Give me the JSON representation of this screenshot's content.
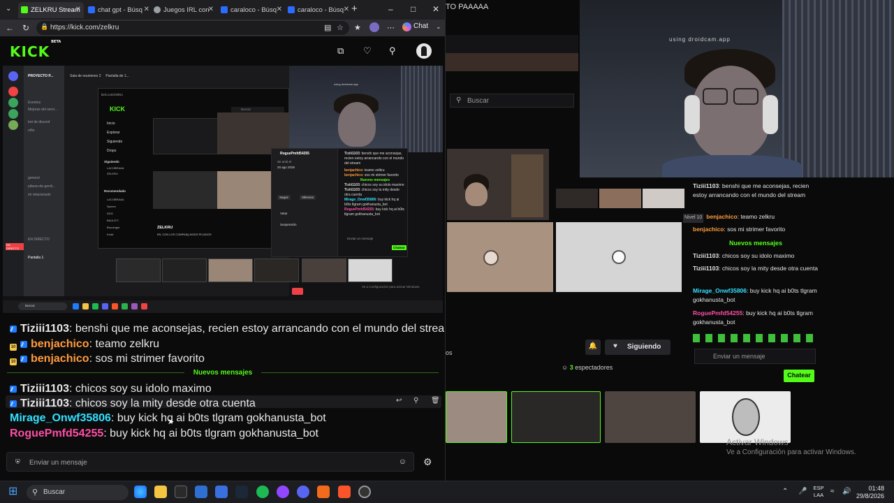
{
  "browser": {
    "tabs": [
      {
        "label": "ZELKRU Stream",
        "active": true,
        "fav_color": "#53fc18"
      },
      {
        "label": "chat gpt - Búsq",
        "active": false,
        "fav_color": "#2b6cff"
      },
      {
        "label": "Juegos IRL con",
        "active": false,
        "fav_color": "#9aa0a6"
      },
      {
        "label": "caraloco - Búsq",
        "active": false,
        "fav_color": "#2b6cff"
      },
      {
        "label": "caraloco - Búsq",
        "active": false,
        "fav_color": "#2b6cff"
      }
    ],
    "url": "https://kick.com/zelkru",
    "chat_button": "Chat"
  },
  "kick": {
    "logo": "KICK",
    "logo_badge": "BETA"
  },
  "nested": {
    "server_name": "PROYECTO P...",
    "inner_search": "Buscar",
    "inner_url": "kick.com/zelkru",
    "inner_nav": [
      "Inicio",
      "Explorar",
      "Siguiendo",
      "Drops"
    ],
    "inner_following_header": "Siguiendo",
    "inner_recommended_header": "Recomendado",
    "inner_channels": [
      "LACOBRAAA",
      "ZELKRU",
      "LACOBRAAA",
      "Spreen",
      "DDG",
      "BAULETI",
      "Brunenger",
      "Kodd"
    ],
    "inner_stream_title": "ZELKRU",
    "inner_stream_sub": "IRL CON LOS COMPAS|| MODS PICADOS",
    "inner_panel_user": "RoguePmfd54255",
    "inner_panel_joined": "Se unió el",
    "inner_panel_date": "20 ago 2026",
    "inner_follow_btn": "Seguir",
    "inner_silence_btn": "Silenciar",
    "inner_ban": "Vetar",
    "inner_suspend": "Suspensión",
    "inner_new": "Nuevos mensajes",
    "inner_send": "Enviar un mensaje",
    "inner_chat_btn": "Chatear",
    "dc_live": "EN DIRECTO",
    "dc_screen": "Pantalla 1",
    "taskbar_search": "Buscar",
    "activate": "Ve a Configuración para activar Windows."
  },
  "background": {
    "title_fragment": "TO PAAAAA",
    "search_placeholder": "Buscar",
    "cam_caption": "using droidcam.app",
    "chat": [
      {
        "user": "Tiziii1103",
        "color": "#e8e8e8",
        "text": "benshi que me aconsejas, recien estoy arrancando con el mundo del stream"
      },
      {
        "user": "benjachico",
        "color": "#ff9b3d",
        "text": "teamo zelkru"
      },
      {
        "user": "benjachico",
        "color": "#ff9b3d",
        "text": "sos mi strimer favorito"
      },
      {
        "user": "Tiziii1103",
        "color": "#e8e8e8",
        "text": "chicos soy su idolo maximo"
      },
      {
        "user": "Tiziii1103",
        "color": "#e8e8e8",
        "text": "chicos soy la mity desde otra cuenta"
      },
      {
        "user": "Mirage_Onwf35806",
        "color": "#33e1ff",
        "text": "buy kick hq ai b0ts tlgram gokhanusta_bot"
      },
      {
        "user": "RoguePmfd54255",
        "color": "#ff4fa3",
        "text": "buy kick hq ai b0ts tlgram gokhanusta_bot"
      }
    ],
    "new_messages": "Nuevos mensajes",
    "nivel_tag": "Nivel 10",
    "send_placeholder": "Enviar un mensaje",
    "chat_button": "Chatear",
    "follow_button": "Siguiendo",
    "viewers_count": "3",
    "viewers_label": "espectadores",
    "sidebar_fragment": "os",
    "activate_title": "Activar Windows",
    "activate_text": "Ve a Configuración para activar Windows."
  },
  "chat": {
    "messages": [
      {
        "badges": [
          "kick"
        ],
        "user": "Tiziii1103",
        "user_color": "#e8e8e8",
        "text": ": benshi que me aconsejas, recien estoy arrancando con el mundo del stream"
      },
      {
        "badges": [
          "ten",
          "kick"
        ],
        "user": "benjachico",
        "user_color": "#ff9b3d",
        "text": ": teamo zelkru"
      },
      {
        "badges": [
          "ten",
          "kick"
        ],
        "user": "benjachico",
        "user_color": "#ff9b3d",
        "text": ": sos mi strimer favorito"
      },
      {
        "badges": [
          "kick"
        ],
        "user": "Tiziii1103",
        "user_color": "#e8e8e8",
        "text": ": chicos soy su idolo maximo"
      },
      {
        "badges": [
          "kick"
        ],
        "user": "Tiziii1103",
        "user_color": "#e8e8e8",
        "text": ": chicos soy la mity desde otra cuenta"
      },
      {
        "badges": [],
        "user": "Mirage_Onwf35806",
        "user_color": "#33e1ff",
        "text": ": buy kick hq ai b0ts tlgram gokhanusta_bot"
      },
      {
        "badges": [],
        "user": "RoguePmfd54255",
        "user_color": "#ff4fa3",
        "text": ": buy kick hq ai b0ts tlgram gokhanusta_bot"
      }
    ],
    "badge_ten_label": "10",
    "new_messages_label": "Nuevos mensajes",
    "input_placeholder": "Enviar un mensaje"
  },
  "taskbar": {
    "search_placeholder": "Buscar",
    "lang_top": "ESP",
    "lang_bottom": "LAA",
    "time": "01:48",
    "date": "29/8/2026"
  },
  "colors": {
    "kick_green": "#53fc18",
    "background": "#0b0b0c"
  }
}
